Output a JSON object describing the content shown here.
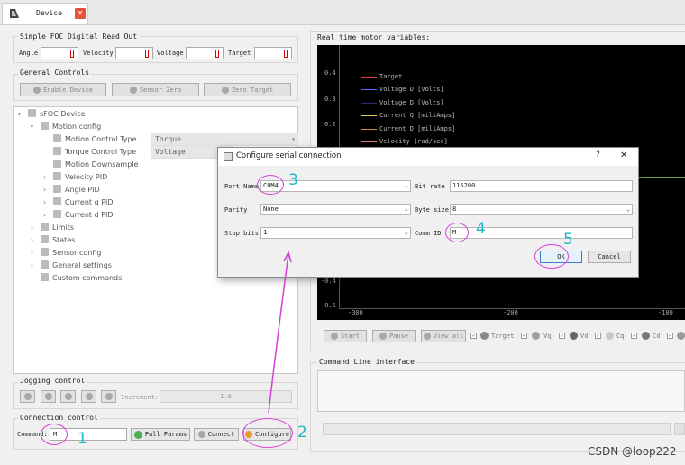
{
  "tab": {
    "title": "Device",
    "close": "✕"
  },
  "readout": {
    "title": "Simple FOC Digital Read Out",
    "fields": [
      {
        "label": "Angle"
      },
      {
        "label": "Velocity"
      },
      {
        "label": "Voltage"
      },
      {
        "label": "Target"
      }
    ]
  },
  "general": {
    "title": "General Controls",
    "enable": "Enable Device",
    "sensor_zero": "Sensor Zero",
    "zero_target": "Zero Target"
  },
  "tree": {
    "root": "sFOC Device",
    "motion_config": "Motion config",
    "mc_type_label": "Motion Control Type",
    "mc_type_value": "Torque",
    "tc_type_label": "Torque Control Type",
    "tc_type_value": "Voltage",
    "downsample": "Motion Downsample",
    "velocity_pid": "Velocity PID",
    "angle_pid": "Angle PID",
    "current_q_pid": "Current q PID",
    "current_d_pid": "Current d PID",
    "limits": "Limits",
    "states": "States",
    "sensor_config": "Sensor config",
    "general_settings": "General settings",
    "custom_commands": "Custom commands"
  },
  "jogging": {
    "title": "Jogging control",
    "increment_label": "Increment:",
    "increment_value": "1.0"
  },
  "connection": {
    "title": "Connection control",
    "command_label": "Command:",
    "command_value": "M",
    "pull_params": "Pull Params",
    "connect": "Connect",
    "configure": "Configure"
  },
  "plot": {
    "title": "Real time motor variables:",
    "y_ticks": [
      "0.4",
      "0.3",
      "0.2",
      "-0.4",
      "-0.5"
    ],
    "x_ticks": [
      "-300",
      "-200",
      "-100"
    ],
    "legend": [
      {
        "name": "Target",
        "color": "#e0413a"
      },
      {
        "name": "Voltage D [Volts]",
        "color": "#5a6cff"
      },
      {
        "name": "Voltage D [Volts]",
        "color": "#3a2a6a"
      },
      {
        "name": "Current Q [miliAmps]",
        "color": "#e6d24a"
      },
      {
        "name": "Current D [miliAmps]",
        "color": "#c89a3a"
      },
      {
        "name": "Velocity [rad/sec]",
        "color": "#e08070"
      }
    ],
    "start": "Start",
    "pause": "Pause",
    "view_all": "View all",
    "checks": [
      {
        "label": "Target",
        "color": "#8a8a8a"
      },
      {
        "label": "Vq",
        "color": "#a0a0a0"
      },
      {
        "label": "Vd",
        "color": "#666"
      },
      {
        "label": "Cq",
        "color": "#c8c8c8"
      },
      {
        "label": "Cd",
        "color": "#777"
      }
    ]
  },
  "cli": {
    "title": "Command Line interface"
  },
  "dialog": {
    "title": "Configure serial connection",
    "help": "?",
    "close": "✕",
    "port_label": "Port Name",
    "port_value": "COM4",
    "bitrate_label": "Bit rate",
    "bitrate_value": "115200",
    "parity_label": "Parity",
    "parity_value": "None",
    "bytesize_label": "Byte size",
    "bytesize_value": "8",
    "stopbits_label": "Stop bits",
    "stopbits_value": "1",
    "commid_label": "Comm ID",
    "commid_value": "M",
    "ok": "OK",
    "cancel": "Cancel"
  },
  "annotations": {
    "n1": "1",
    "n2": "2",
    "n3": "3",
    "n4": "4",
    "n5": "5",
    "accent": "#d63fd6",
    "number_color": "#1fb7c7"
  },
  "watermark": "CSDN @loop222"
}
